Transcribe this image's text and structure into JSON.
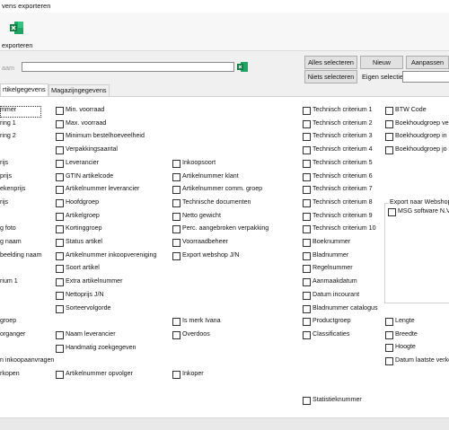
{
  "window": {
    "title": "vens exporteren"
  },
  "ribbon": {
    "label": "exporteren",
    "icon": "excel-icon"
  },
  "name_field": {
    "label": "aam",
    "value": "",
    "icon": "excel-icon"
  },
  "buttons": {
    "alles_selecteren": "Alles selecteren",
    "nieuw": "Nieuw",
    "aanpassen": "Aanpassen",
    "niets_selecteren": "Niets selecteren",
    "eigen_selectie": "Eigen selectie"
  },
  "tabs": [
    {
      "label": "rtikelgegevens",
      "active": true
    },
    {
      "label": "Magazijngegevens",
      "active": false
    }
  ],
  "left_labels": [
    "mmer",
    "ring 1",
    "ring 2",
    "",
    "rijs",
    "prijs",
    "ekenprijs",
    "rijs",
    "",
    "g foto",
    "g naam",
    "beelding naam",
    "",
    "rium 1",
    "",
    "",
    "groep",
    "organger",
    "",
    "n inkoopaanvragen",
    "rkopen"
  ],
  "col2": [
    "Min. voorraad",
    "Max. voorraad",
    "Minimum bestelhoeveelheid",
    "Verpakkingsaantal",
    "Leverancier",
    "GTIN artikelcode",
    "Artikelnummer leverancier",
    "Hoofdgroep",
    "Artikelgroep",
    "Kortinggroep",
    "Status artikel",
    "Artikelnummer inkoopvereniging",
    "Soort artikel",
    "Extra artikelnummer",
    "Nettoprijs J/N",
    "Sorteervolgorde",
    "",
    "Naam leverancier",
    "Handmatig zoekgegeven",
    "",
    "Artikelnummer opvolger"
  ],
  "col3": [
    "",
    "",
    "",
    "",
    "Inkoopsoort",
    "Artikelnummer klant",
    "Artikelnummer comm. groep",
    "Technische documenten",
    "Netto gewicht",
    "Perc. aangebroken verpakking",
    "Voorraadbeheer",
    "Export webshop J/N",
    "",
    "",
    "",
    "",
    "Is merk Ivana",
    "Overdoos",
    "",
    "",
    "Inkoper"
  ],
  "col4": [
    "Technisch criterium 1",
    "Technisch criterium 2",
    "Technisch criterium 3",
    "Technisch criterium 4",
    "Technisch criterium 5",
    "Technisch criterium 6",
    "Technisch criterium 7",
    "Technisch criterium 8",
    "Technisch criterium 9",
    "Technisch criterium 10",
    "Boeknummer",
    "Bladnummer",
    "Regelnummer",
    "Aanmaakdatum",
    "Datum incourant",
    "Bladnummer catalogus",
    "Productgroep",
    "Classificaties",
    "",
    "",
    "",
    "",
    "Statistieknummer"
  ],
  "col5": [
    "BTW Code",
    "Boekhoudgroep ve",
    "Boekhoudgroep in",
    "Boekhoudgroep jo"
  ],
  "col5b": [
    "Lengte",
    "Breedte",
    "Hoogte",
    "Datum laatste verko"
  ],
  "webshop_group": {
    "title": "Export naar Webshop",
    "items": [
      "MSG software N.V."
    ]
  }
}
